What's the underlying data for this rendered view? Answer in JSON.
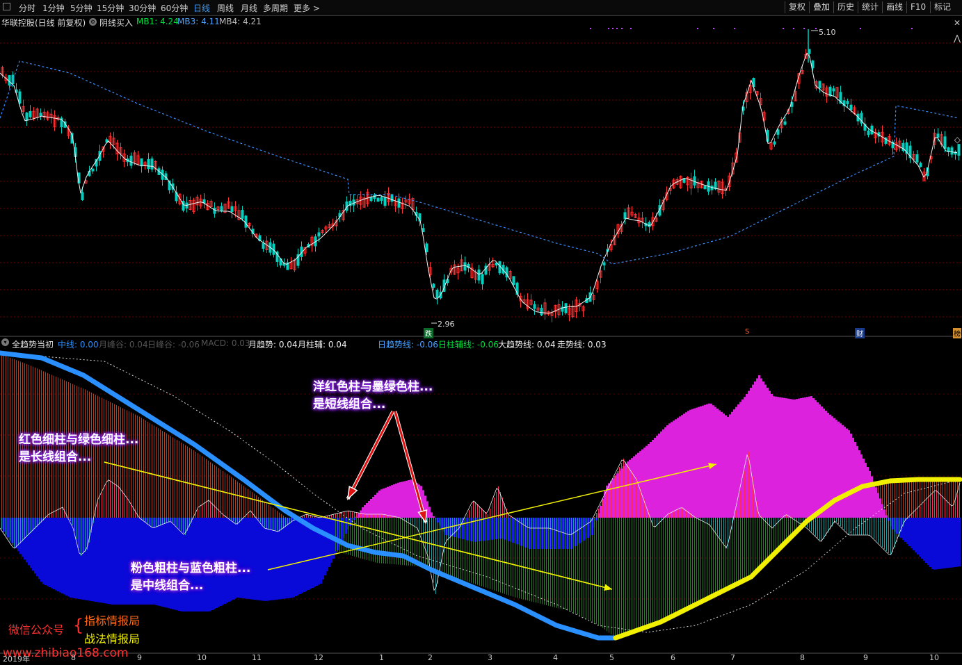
{
  "toolbar": {
    "periods": [
      "分时",
      "1分钟",
      "5分钟",
      "15分钟",
      "30分钟",
      "60分钟",
      "日线",
      "周线",
      "月线",
      "多周期",
      "更多 >"
    ],
    "active_period": "日线",
    "right_buttons": [
      "复权",
      "叠加",
      "历史",
      "统计",
      "画线",
      "F10",
      "标记"
    ]
  },
  "header": {
    "stock": "华联控股(日线 前复权)",
    "indicator": "阴线买入",
    "mb1": "MB1: 4.24",
    "mb3": "MB3: 4.11",
    "mb4": "MB4: 4.21"
  },
  "price_labels": {
    "high": "5.10",
    "low": "2.96"
  },
  "event_markers": {
    "die": "跌",
    "s": "S",
    "cai": "财",
    "bang": "榜"
  },
  "sub_header": {
    "name": "全趋势当初",
    "mid": "中线: 0.00",
    "m_peak": "月峰谷: 0.04",
    "d_peak": "日峰谷: -0.06",
    "macd": "MACD: 0.03",
    "m_trend": "月趋势: 0.04",
    "m_aux": "月柱辅: 0.04",
    "d_trend": "日趋势线: -0.06",
    "d_aux": "日柱辅线: -0.06",
    "big_trend": "大趋势线: 0.04",
    "walk": "走势线: 0.03"
  },
  "annotations": {
    "short_1": "洋红色柱与墨绿色柱...",
    "short_2": "是短线组合...",
    "long_1": "红色细柱与绿色细柱...",
    "long_2": "是长线组合...",
    "mid_1": "粉色粗柱与蓝色粗柱...",
    "mid_2": "是中线组合..."
  },
  "watermark": {
    "label": "微信公众号",
    "name1": "指标情报局",
    "name2": "战法情报局",
    "url": "www.zhibiao168.com"
  },
  "x_axis": [
    "2019年",
    "8",
    "9",
    "10",
    "11",
    "12",
    "1",
    "2",
    "3",
    "4",
    "5",
    "6",
    "7",
    "8",
    "9",
    "10"
  ],
  "colors": {
    "up": "#ff3333",
    "down": "#00d0c0",
    "grid": "#7a0000",
    "hist_red": "#b04020",
    "hist_teal": "#1aa0a0",
    "blue_bar": "#0a0ad8",
    "magenta_bar": "#dd22dd",
    "pink_bar": "#ff2860",
    "green_bar": "#0d4d1a",
    "thick_blue": "#2a90ff",
    "thick_yellow": "#f0f000"
  }
}
